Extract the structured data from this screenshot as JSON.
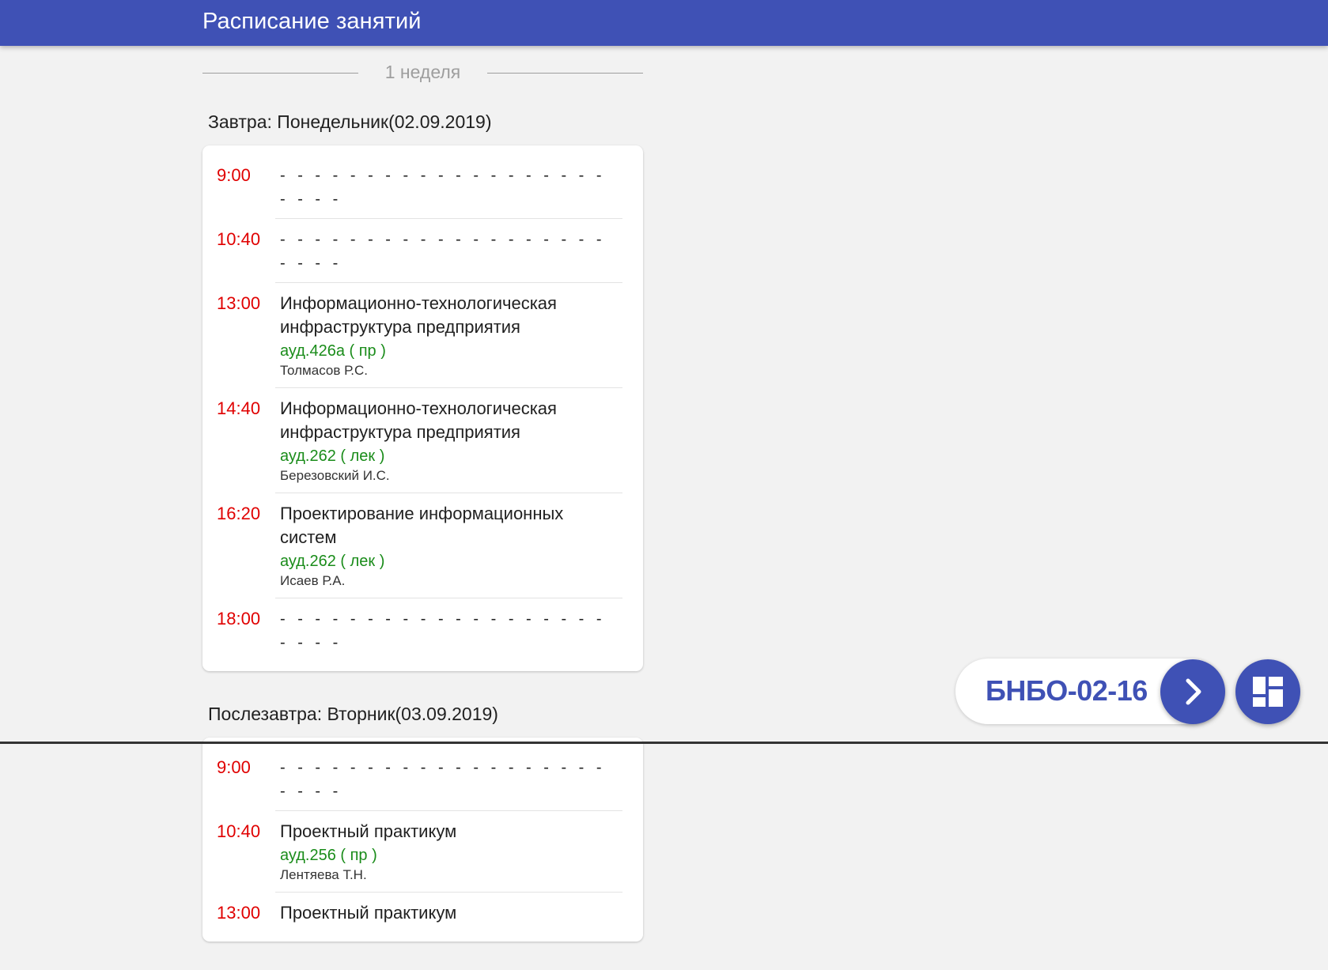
{
  "app": {
    "title": "Расписание занятий"
  },
  "week": {
    "label": "1 неделя"
  },
  "days": [
    {
      "title": "Завтра: Понедельник(02.09.2019)",
      "lessons": [
        {
          "time": "9:00",
          "empty": "- - - - - - - - - - - - - - - - - - - - - - -"
        },
        {
          "time": "10:40",
          "empty": "- - - - - - - - - - - - - - - - - - - - - - -"
        },
        {
          "time": "13:00",
          "subject": "Информационно-технологическая инфраструктура предприятия",
          "room": "ауд.426а ( пр )",
          "teacher": "Толмасов Р.С."
        },
        {
          "time": "14:40",
          "subject": "Информационно-технологическая инфраструктура предприятия",
          "room": "ауд.262 ( лек )",
          "teacher": "Березовский И.С."
        },
        {
          "time": "16:20",
          "subject": "Проектирование информационных систем",
          "room": "ауд.262 ( лек )",
          "teacher": "Исаев Р.А."
        },
        {
          "time": "18:00",
          "empty": "- - - - - - - - - - - - - - - - - - - - - - -"
        }
      ]
    },
    {
      "title": "Послезавтра: Вторник(03.09.2019)",
      "lessons": [
        {
          "time": "9:00",
          "empty": "- - - - - - - - - - - - - - - - - - - - - - -"
        },
        {
          "time": "10:40",
          "subject": "Проектный практикум",
          "room": "ауд.256 ( пр )",
          "teacher": "Лентяева Т.Н."
        },
        {
          "time": "13:00",
          "subject": "Проектный практикум"
        }
      ]
    }
  ],
  "group_selector": {
    "group": "БНБО-02-16"
  },
  "icons": {
    "next": "chevron-right-icon",
    "grid": "dashboard-grid-icon"
  },
  "colors": {
    "primary": "#3f51b5",
    "time": "#e00000",
    "room": "#1a8c1a"
  }
}
